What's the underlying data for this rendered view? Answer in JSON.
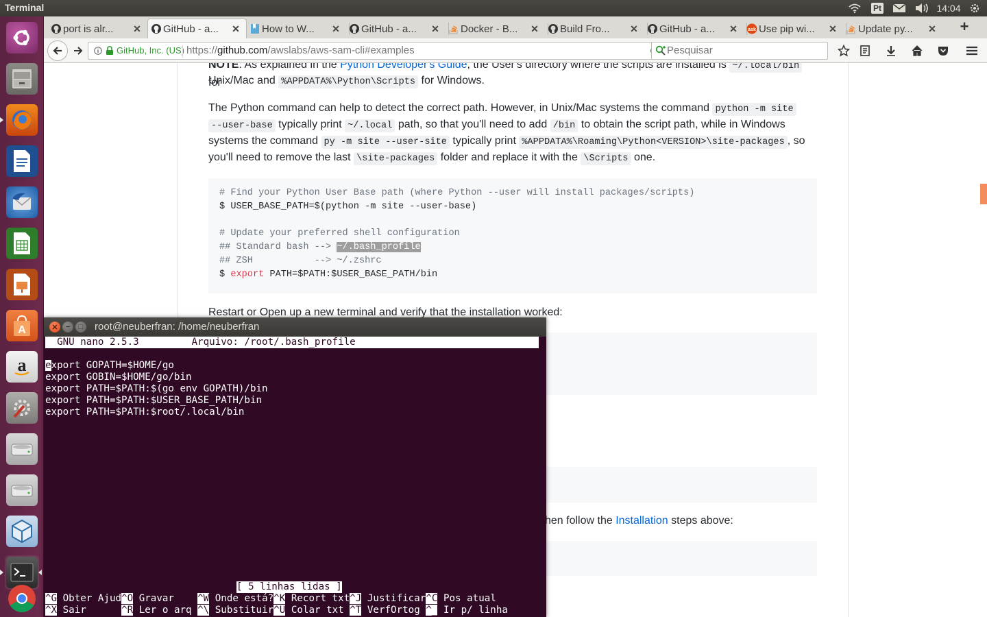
{
  "top_panel": {
    "app_title": "Terminal",
    "keyboard_indicator": "Pt",
    "clock": "14:04",
    "tray_icons": [
      "wifi-icon",
      "keyboard-indicator",
      "mail-icon",
      "volume-icon"
    ]
  },
  "launcher": {
    "items": [
      {
        "name": "ubuntu-dash",
        "icon": "ubuntu-logo-icon",
        "color": "#dd4814"
      },
      {
        "name": "files",
        "icon": "file-cabinet-icon",
        "color": "#8a8a86"
      },
      {
        "name": "firefox",
        "icon": "firefox-icon",
        "color": "#e66000"
      },
      {
        "name": "libreoffice-writer",
        "icon": "writer-icon",
        "color": "#2a5ea6"
      },
      {
        "name": "thunderbird",
        "icon": "thunderbird-icon",
        "color": "#3d80c8"
      },
      {
        "name": "libreoffice-calc",
        "icon": "calc-icon",
        "color": "#3f9a3c"
      },
      {
        "name": "libreoffice-impress",
        "icon": "impress-icon",
        "color": "#c5571b"
      },
      {
        "name": "software-center",
        "icon": "shopping-bag-icon",
        "color": "#e8692c"
      },
      {
        "name": "amazon",
        "icon": "amazon-icon",
        "color": "#e6e6e6"
      },
      {
        "name": "system-settings",
        "icon": "settings-wrench-icon",
        "color": "#9b9b9b"
      },
      {
        "name": "drive-1",
        "icon": "hard-drive-icon",
        "color": "#bdbdbd"
      },
      {
        "name": "drive-2",
        "icon": "hard-drive-icon",
        "color": "#bdbdbd"
      },
      {
        "name": "virtualbox",
        "icon": "virtualbox-icon",
        "color": "#2f6ea5"
      },
      {
        "name": "terminal",
        "icon": "terminal-icon",
        "color": "#2b2b2b"
      },
      {
        "name": "chrome",
        "icon": "chrome-icon",
        "color": "#db4437"
      }
    ]
  },
  "browser": {
    "tabs": [
      {
        "label": "port is alr...",
        "icon": "github-icon",
        "active": false
      },
      {
        "label": "GitHub - a...",
        "icon": "github-icon",
        "active": true
      },
      {
        "label": "How to W...",
        "icon": "bookmark-page-icon",
        "active": false
      },
      {
        "label": "GitHub - a...",
        "icon": "github-icon",
        "active": false
      },
      {
        "label": "Docker - B...",
        "icon": "stackoverflow-icon",
        "active": false
      },
      {
        "label": "Build Fro...",
        "icon": "github-icon",
        "active": false
      },
      {
        "label": "GitHub - a...",
        "icon": "github-icon",
        "active": false
      },
      {
        "label": "Use pip wi...",
        "icon": "askubuntu-icon",
        "active": false
      },
      {
        "label": "Update py...",
        "icon": "stackoverflow-icon",
        "active": false
      }
    ],
    "new_tab_label": "+",
    "identity": "GitHub, Inc. (US)",
    "url_prefix": "https://",
    "url_host": "github.com",
    "url_path": "/awslabs/aws-sam-cli#examples",
    "search_placeholder": "Pesquisar"
  },
  "article": {
    "note_prefix": "NOTE",
    "note_text_1": ": As explained in the ",
    "note_link": "Python Developer's Guide",
    "note_text_2": ", the User's directory where the scripts are installed is ",
    "note_code_1": "~/.local/bin",
    "note_text_3": " for",
    "note_line2_a": "Unix/Mac and ",
    "note_code_2": "%APPDATA%\\Python\\Scripts",
    "note_line2_b": " for Windows.",
    "p2_a": "The Python command can help to detect the correct path. However, in Unix/Mac systems the command ",
    "p2_code_1": "python -m site",
    "p2_code_2": "--user-base",
    "p2_b": " typically print ",
    "p2_code_3": "~/.local",
    "p2_c": " path, so that you'll need to add ",
    "p2_code_4": "/bin",
    "p2_d": " to obtain the script path, while in Windows",
    "p2_e": "systems the command ",
    "p2_code_5": "py -m site --user-site",
    "p2_f": " typically print ",
    "p2_code_6": "%APPDATA%\\Roaming\\Python<VERSION>\\site-packages",
    "p2_g": ", so",
    "p2_h": "you'll need to remove the last ",
    "p2_code_7": "\\site-packages",
    "p2_i": " folder and replace it with the ",
    "p2_code_8": "\\Scripts",
    "p2_j": " one.",
    "code_line_1": "# Find your Python User Base path (where Python --user will install packages/scripts)",
    "code_line_2": "$ USER_BASE_PATH=$(python -m site --user-base)",
    "code_line_3": "# Update your preferred shell configuration",
    "code_line_4_a": "## Standard bash --> ",
    "code_line_4_b": "~/.bash_profile",
    "code_line_5": "## ZSH           --> ~/.zshrc",
    "code_line_6_a": "$ ",
    "code_line_6_b": "export",
    "code_line_6_c": " PATH=$PATH:$USER_BASE_PATH/bin",
    "restart_text": "Restart or Open up a new terminal and verify that the installation worked:",
    "follow_text_a": "hen follow the ",
    "follow_link": "Installation",
    "follow_text_b": " steps above:"
  },
  "terminal": {
    "title": "root@neuberfran: /home/neuberfran",
    "nano_header": "  GNU nano 2.5.3         Arquivo: /root/.bash_profile",
    "cursor_char": "e",
    "lines": [
      "xport GOPATH=$HOME/go",
      "export GOBIN=$HOME/go/bin",
      "export PATH=$PATH:$(go env GOPATH)/bin",
      "export PATH=$PATH:$USER_BASE_PATH/bin",
      "export PATH=$PATH:$root/.local/bin"
    ],
    "status": "[ 5 linhas lidas ]",
    "help_row_1": [
      {
        "key": "^G",
        "label": " Obter Ajud"
      },
      {
        "key": "^O",
        "label": " Gravar    "
      },
      {
        "key": "^W",
        "label": " Onde está?"
      },
      {
        "key": "^K",
        "label": " Recort txt"
      },
      {
        "key": "^J",
        "label": " Justificar"
      },
      {
        "key": "^C",
        "label": " Pos atual"
      }
    ],
    "help_row_2": [
      {
        "key": "^X",
        "label": " Sair      "
      },
      {
        "key": "^R",
        "label": " Ler o arq "
      },
      {
        "key": "^\\",
        "label": " Substituir"
      },
      {
        "key": "^U",
        "label": " Colar txt "
      },
      {
        "key": "^T",
        "label": " VerfOrtog "
      },
      {
        "key": "^_",
        "label": " Ir p/ linha"
      }
    ]
  },
  "colors": {
    "terminal_bg": "#300a24",
    "launcher_bg": "#5e2750",
    "link": "#0366d6",
    "code_bg": "#f6f8fa"
  }
}
